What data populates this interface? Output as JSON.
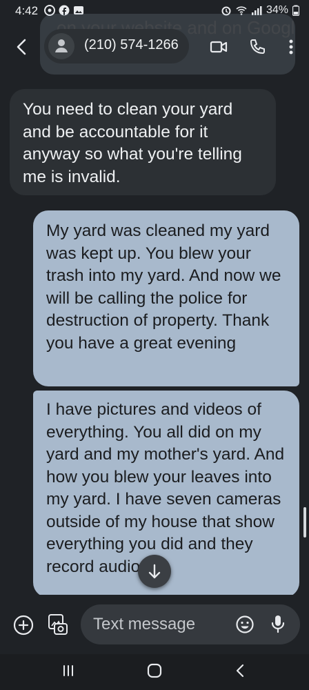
{
  "status_bar": {
    "time": "4:42",
    "battery": "34%"
  },
  "header": {
    "contact_title": "(210) 574-1266",
    "partial_previous_text": "on your website and on Google. I know what I leave"
  },
  "messages": [
    {
      "direction": "incoming",
      "text": "You need to clean your yard and be accountable for it anyway so what you're telling me is invalid."
    },
    {
      "direction": "outgoing",
      "text": "My yard was cleaned my yard was kept up. You blew your trash into my yard. And now we will be calling the police for destruction of property. Thank you have a great evening"
    },
    {
      "direction": "outgoing",
      "text": "I have pictures and videos of everything. You all did on my yard and my mother's yard. And how you blew your leaves into my yard. I have seven cameras outside of my house that show everything you did and they record audio."
    }
  ],
  "compose": {
    "placeholder": "Text message"
  },
  "colors": {
    "background": "#1f2226",
    "incoming_bubble": "#2c3034",
    "outgoing_bubble": "#a8b9cc"
  }
}
